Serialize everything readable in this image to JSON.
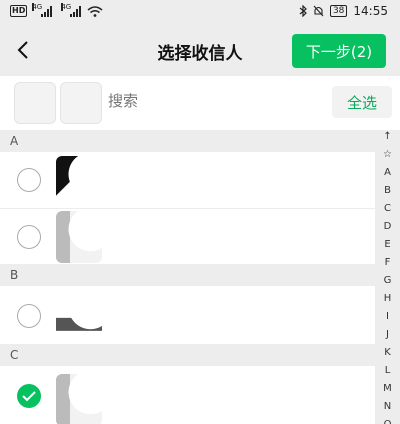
{
  "status": {
    "time": "14:55",
    "battery": "38",
    "hd": "HD",
    "net1": "4G",
    "net2": "4G"
  },
  "header": {
    "title": "选择收信人",
    "next_label": "下一步(2)"
  },
  "search": {
    "placeholder": "搜索",
    "select_all_label": "全选"
  },
  "sections": [
    "A",
    "B",
    "C"
  ],
  "rows": [
    {
      "section": "A",
      "checked": false
    },
    {
      "section": "A",
      "checked": false
    },
    {
      "section": "B",
      "checked": false
    },
    {
      "section": "C",
      "checked": true
    }
  ],
  "index": [
    "↑",
    "☆",
    "A",
    "B",
    "C",
    "D",
    "E",
    "F",
    "G",
    "H",
    "I",
    "J",
    "K",
    "L",
    "M",
    "N",
    "O"
  ],
  "colors": {
    "accent": "#07c160",
    "background": "#ededed"
  }
}
